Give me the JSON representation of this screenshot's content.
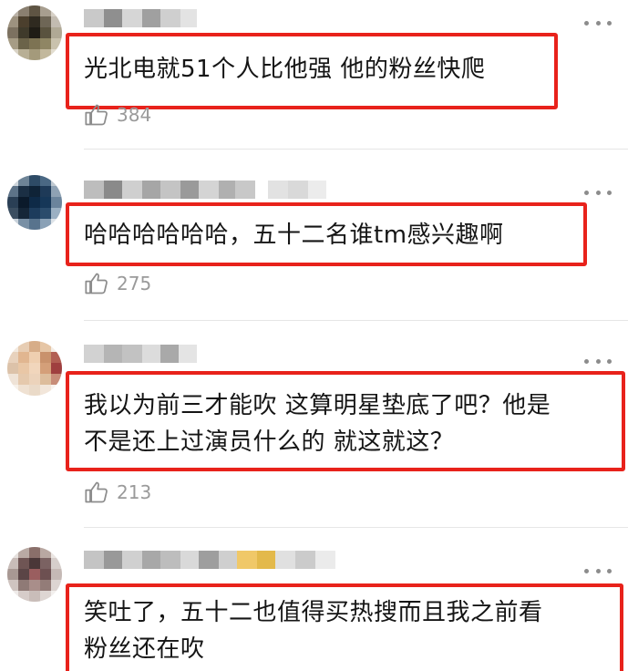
{
  "comments": [
    {
      "text": "光北电就51个人比他强 他的粉丝快爬",
      "likes": "384"
    },
    {
      "text": "哈哈哈哈哈哈，五十二名谁tm感兴趣啊",
      "likes": "275"
    },
    {
      "text": "我以为前三才能吹 这算明星垫底了吧？他是\n不是还上过演员什么的 就这就这？",
      "likes": "213"
    },
    {
      "text": "笑吐了，五十二也值得买热搜而且我之前看\n粉丝还在吹",
      "likes": ""
    }
  ],
  "colors": {
    "highlight": "#e8221b",
    "meta": "#9a9a9a"
  },
  "icons": {
    "like": "thumbs-up-icon",
    "more": "more-dots-icon"
  }
}
